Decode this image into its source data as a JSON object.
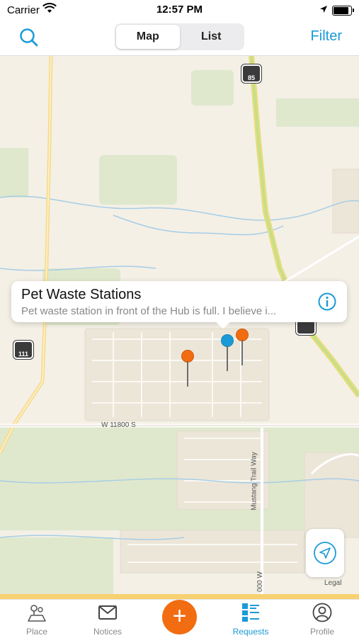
{
  "status_bar": {
    "carrier": "Carrier",
    "time": "12:57 PM"
  },
  "nav": {
    "segments": [
      {
        "label": "Map",
        "active": true
      },
      {
        "label": "List",
        "active": false
      }
    ],
    "filter_label": "Filter"
  },
  "map": {
    "callout": {
      "title": "Pet Waste Stations",
      "subtitle": "Pet waste station in front of the Hub is full. I believe i..."
    },
    "road_labels": {
      "w11800": "W 11800 S",
      "mustang": "Mustang Trail Way",
      "w1000": "000 W",
      "legal": "Legal"
    },
    "shields": {
      "north": "85",
      "west": "111"
    },
    "pins": [
      {
        "color": "#1a9bd7"
      },
      {
        "color": "#f26c12"
      },
      {
        "color": "#f26c12"
      }
    ]
  },
  "tabs": [
    {
      "label": "Place",
      "icon": "place-icon",
      "active": false
    },
    {
      "label": "Notices",
      "icon": "envelope-icon",
      "active": false
    },
    {
      "label": "Requests",
      "icon": "requests-list-icon",
      "active": true
    },
    {
      "label": "Profile",
      "icon": "profile-icon",
      "active": false
    }
  ],
  "fab_label": "+",
  "colors": {
    "accent": "#1a9bd7",
    "fab": "#f26c12",
    "strip": "#f7d170"
  }
}
